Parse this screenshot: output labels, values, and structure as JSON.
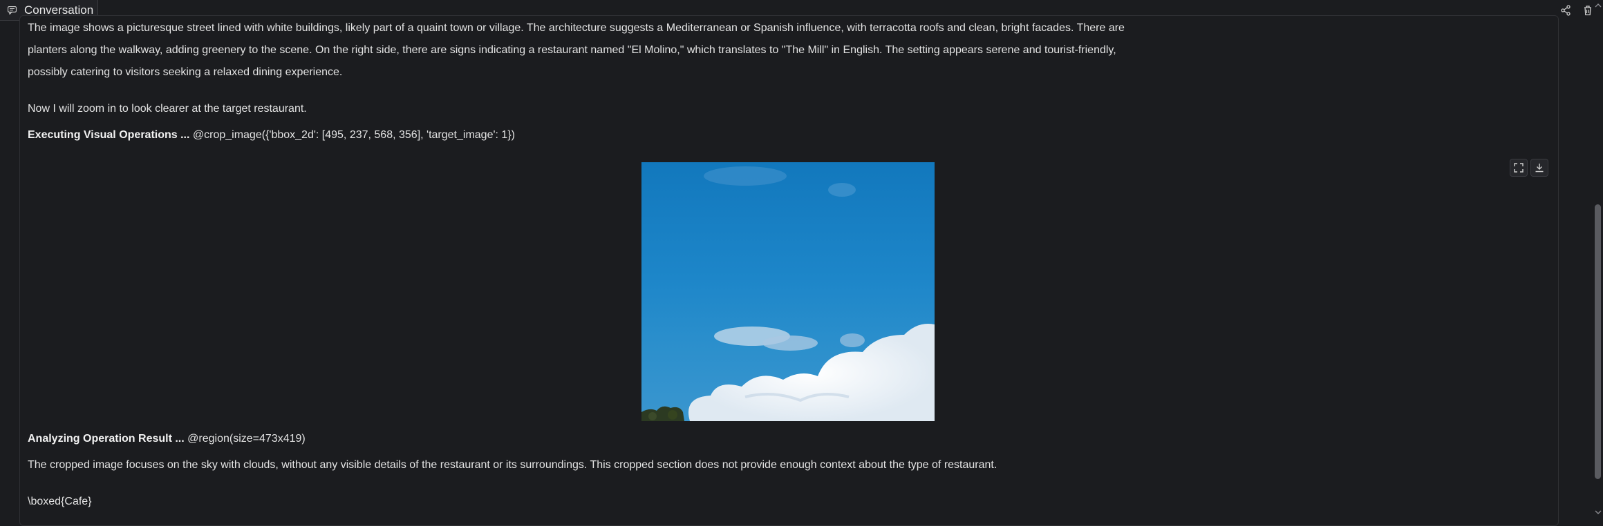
{
  "tab": {
    "label": "Conversation",
    "icon": "chat-icon"
  },
  "top_actions": [
    {
      "name": "share-icon"
    },
    {
      "name": "delete-icon"
    }
  ],
  "message": {
    "description": [
      "The image shows a picturesque street lined with white buildings, likely part of a quaint town or village. The architecture suggests a Mediterranean or Spanish influence, with terracotta roofs and clean, bright facades. There are",
      "planters along the walkway, adding greenery to the scene. On the right side, there are signs indicating a restaurant named \"El Molino,\" which translates to \"The Mill\" in English. The setting appears serene and tourist-friendly,",
      "possibly catering to visitors seeking a relaxed dining experience."
    ],
    "zoom_text": "Now I will zoom in to look clearer at the target restaurant.",
    "exec_label": "Executing Visual Operations ...",
    "exec_call": " @crop_image({'bbox_2d': [495, 237, 568, 356], 'target_image': 1})",
    "image_actions": [
      {
        "name": "fullscreen-icon"
      },
      {
        "name": "download-icon"
      }
    ],
    "analyze_label": "Analyzing Operation Result ...",
    "analyze_call": " @region(size=473x419)",
    "analysis_text": "The cropped image focuses on the sky with clouds, without any visible details of the restaurant or its surroundings. This cropped section does not provide enough context about the type of restaurant.",
    "answer": "\\boxed{Cafe}"
  }
}
